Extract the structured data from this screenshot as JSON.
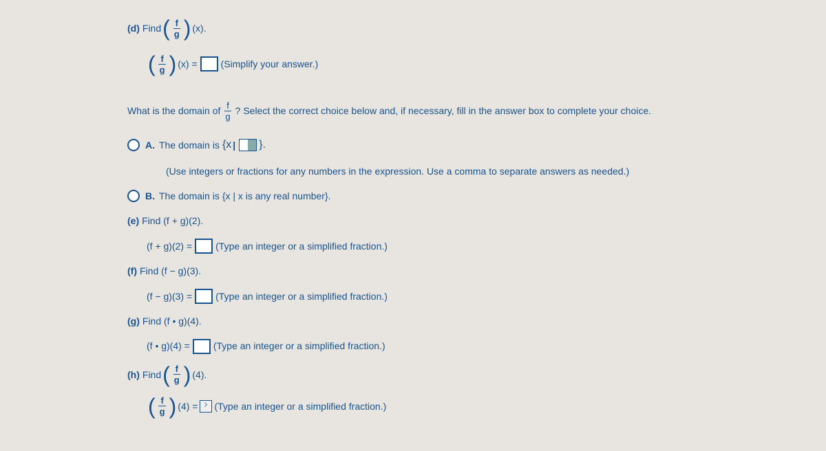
{
  "partD": {
    "label": "(d)",
    "find": "Find",
    "func_num": "f",
    "func_den": "g",
    "arg": "(x).",
    "equals": "(x) =",
    "instruction": "(Simplify your answer.)"
  },
  "domainQuestion": {
    "prefix": "What is the domain of",
    "num": "f",
    "den": "g",
    "suffix": "? Select the correct choice below and, if necessary, fill in the answer box to complete your choice."
  },
  "optionA": {
    "label": "A.",
    "text1": "The domain is",
    "brace_open": "{x",
    "brace_close": "}.",
    "hint": "(Use integers or fractions for any numbers in the expression. Use a comma to separate answers as needed.)"
  },
  "optionB": {
    "label": "B.",
    "text": "The domain is {x | x is any real number}."
  },
  "partE": {
    "label": "(e)",
    "text": "Find (f + g)(2).",
    "expr": "(f + g)(2) =",
    "hint": "(Type an integer or a simplified fraction.)"
  },
  "partF": {
    "label": "(f)",
    "text": "Find (f − g)(3).",
    "expr": "(f − g)(3) =",
    "hint": "(Type an integer or a simplified fraction.)"
  },
  "partG": {
    "label": "(g)",
    "text": "Find (f • g)(4).",
    "expr": "(f • g)(4) =",
    "hint": "(Type an integer or a simplified fraction.)"
  },
  "partH": {
    "label": "(h)",
    "find": "Find",
    "num": "f",
    "den": "g",
    "arg": "(4).",
    "equals": "(4) =",
    "hint": "(Type an integer or a simplified fraction.)"
  }
}
